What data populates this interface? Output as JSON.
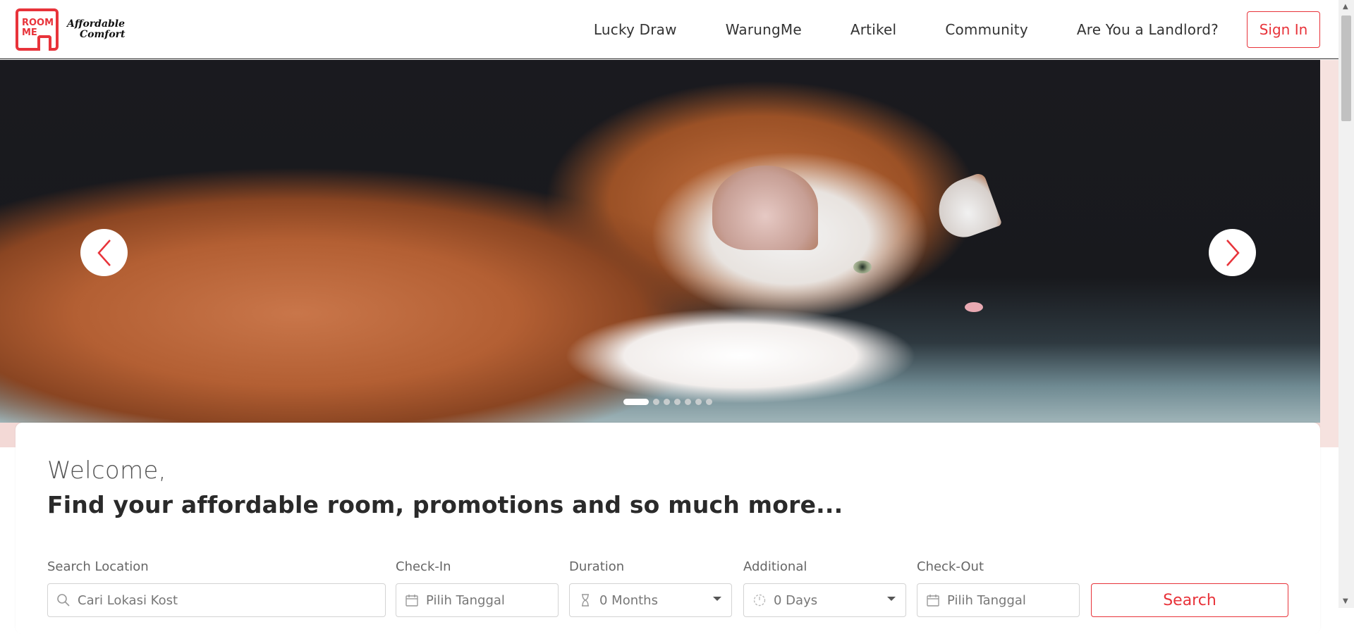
{
  "logo": {
    "line1": "ROOM",
    "line2": "ME",
    "tag1": "Affordable",
    "tag2": "Comfort"
  },
  "nav": {
    "items": [
      "Lucky Draw",
      "WarungMe",
      "Artikel",
      "Community",
      "Are You a Landlord?"
    ],
    "signin": "Sign In"
  },
  "hero": {
    "slide_count": 7,
    "active_slide": 1,
    "prev_icon": "chevron-left-icon",
    "next_icon": "chevron-right-icon"
  },
  "welcome": {
    "greeting": "Welcome,",
    "headline": "Find your affordable room, promotions and so much more..."
  },
  "search": {
    "location_label": "Search Location",
    "location_placeholder": "Cari Lokasi Kost",
    "checkin_label": "Check-In",
    "checkin_placeholder": "Pilih Tanggal",
    "duration_label": "Duration",
    "duration_value": "0 Months",
    "additional_label": "Additional",
    "additional_value": "0 Days",
    "checkout_label": "Check-Out",
    "checkout_placeholder": "Pilih Tanggal",
    "button": "Search"
  },
  "colors": {
    "brand": "#e8333a"
  }
}
